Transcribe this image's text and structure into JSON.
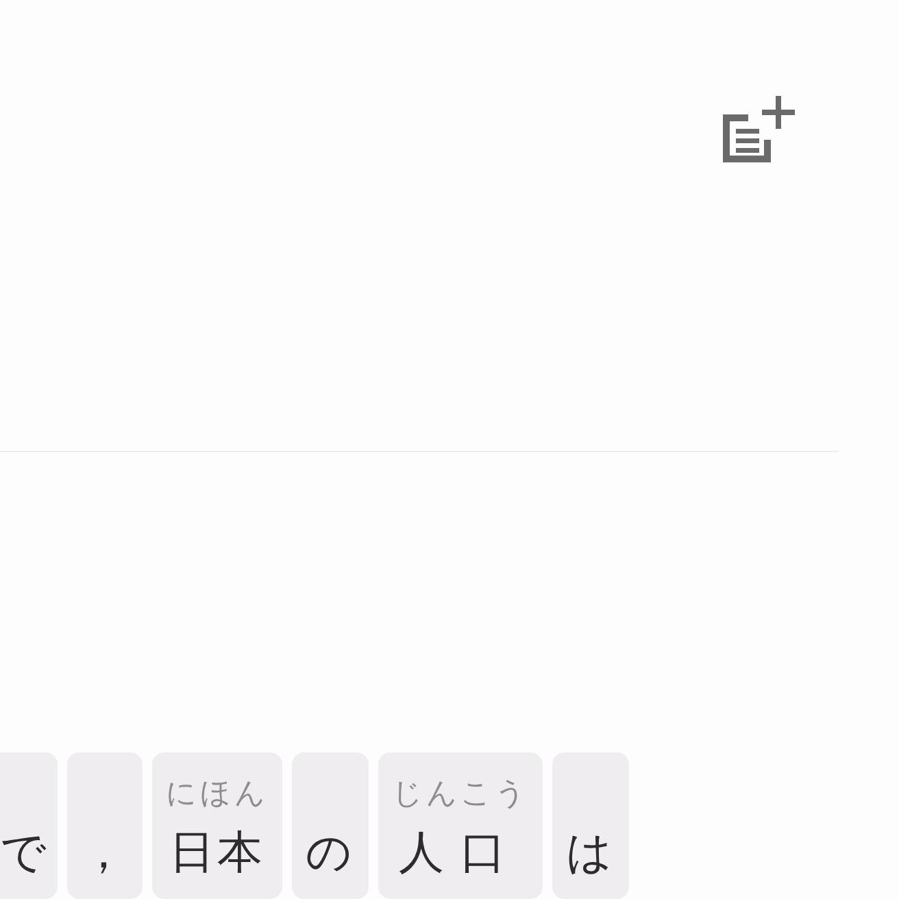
{
  "tokens": [
    {
      "text": "で"
    },
    {
      "text": "，"
    },
    {
      "text": "日本",
      "reading": "にほん"
    },
    {
      "text": "の"
    },
    {
      "text": "人口",
      "reading": "じんこう"
    },
    {
      "text": "は"
    }
  ]
}
